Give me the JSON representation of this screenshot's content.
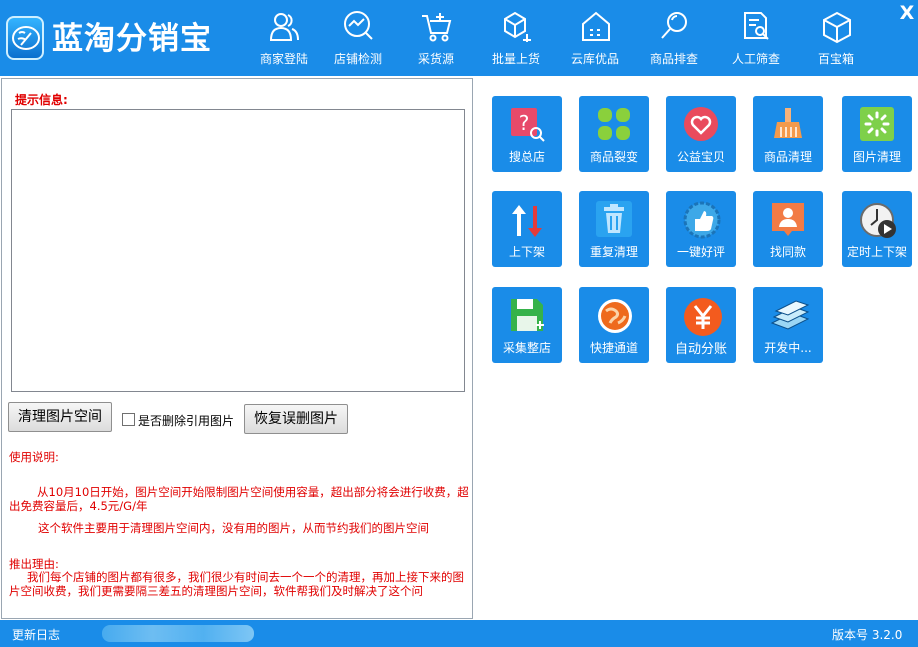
{
  "app": {
    "title": "蓝淘分销宝",
    "close_label": "X"
  },
  "nav": [
    {
      "label": "商家登陆",
      "icon": "user-group-icon"
    },
    {
      "label": "店铺检测",
      "icon": "search-chart-icon"
    },
    {
      "label": "采货源",
      "icon": "cart-add-icon"
    },
    {
      "label": "批量上货",
      "icon": "box-upload-icon"
    },
    {
      "label": "云库优品",
      "icon": "warehouse-icon"
    },
    {
      "label": "商品排查",
      "icon": "magnifier-icon"
    },
    {
      "label": "人工筛查",
      "icon": "document-search-icon"
    },
    {
      "label": "百宝箱",
      "icon": "treasure-box-icon"
    }
  ],
  "left": {
    "hint_label": "提示信息:",
    "info_value": "",
    "clean_button": "清理图片空间",
    "delete_ref_label": "是否删除引用图片",
    "delete_ref_checked": false,
    "restore_button": "恢复误删图片",
    "usage_title": "使用说明:",
    "usage_p1": "从10月10日开始，图片空间开始限制图片空间使用容量，超出部分将会进行收费，超出免费容量后，4.5元/G/年",
    "usage_p2": "这个软件主要用于清理图片空间内，没有用的图片，从而节约我们的图片空间",
    "reason_title": "推出理由:",
    "reason_body": "我们每个店铺的图片都有很多，我们很少有时间去一个一个的清理，再加上接下来的图片空间收费，我们更需要隔三差五的清理图片空间，软件帮我们及时解决了这个问"
  },
  "tiles": [
    {
      "label": "搜总店",
      "icon": "question-search-icon"
    },
    {
      "label": "商品裂变",
      "icon": "four-leaf-icon"
    },
    {
      "label": "公益宝贝",
      "icon": "heart-icon"
    },
    {
      "label": "商品清理",
      "icon": "broom-icon"
    },
    {
      "label": "图片清理",
      "icon": "image-clean-icon"
    },
    {
      "label": "上下架",
      "icon": "up-down-arrow-icon"
    },
    {
      "label": "重复清理",
      "icon": "trash-icon"
    },
    {
      "label": "一键好评",
      "icon": "thumbs-up-icon"
    },
    {
      "label": "找同款",
      "icon": "person-card-icon"
    },
    {
      "label": "定时上下架",
      "icon": "clock-play-icon"
    },
    {
      "label": "采集整店",
      "icon": "save-disk-icon"
    },
    {
      "label": "快捷通道",
      "icon": "globe-icon"
    },
    {
      "label": "自动分账",
      "icon": "yen-coin-icon"
    },
    {
      "label": "开发中...",
      "icon": "stacked-books-icon"
    }
  ],
  "status": {
    "changelog": "更新日志",
    "version": "版本号 3.2.0"
  },
  "colors": {
    "primary": "#1a8ce8",
    "warning_text": "#e00000"
  }
}
